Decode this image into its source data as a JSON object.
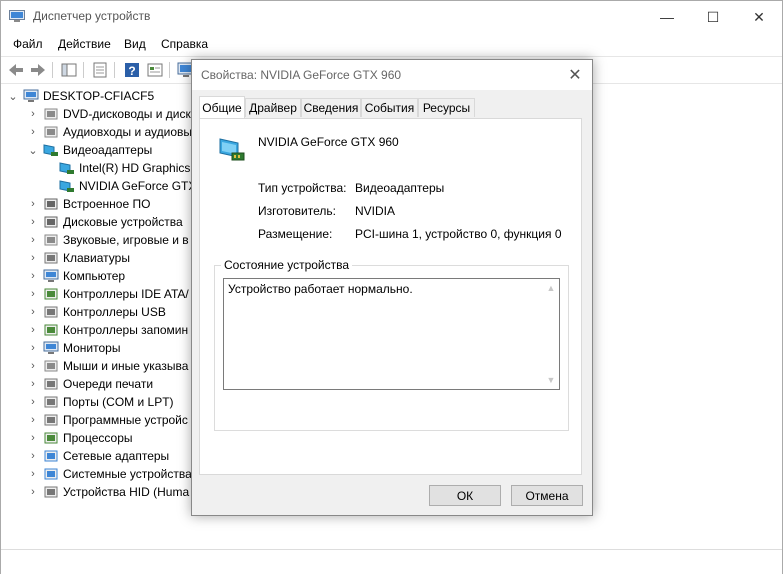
{
  "window": {
    "title": "Диспетчер устройств",
    "icon": "device-manager-icon",
    "controls": {
      "minimize": "—",
      "maximize": "☐",
      "close": "✕"
    }
  },
  "menu": [
    "Файл",
    "Действие",
    "Вид",
    "Справка"
  ],
  "toolbar": [
    "back-arrow-icon",
    "forward-arrow-icon",
    "show-hide-tree-icon",
    "properties-icon",
    "help-icon",
    "details-view-icon",
    "monitor-icon"
  ],
  "tree": {
    "root": "DESKTOP-CFIACF5",
    "items": [
      {
        "label": "DVD-дисководы и дисков",
        "icon": "dvd-drive-icon",
        "expanded": false
      },
      {
        "label": "Аудиовходы и аудиовых",
        "icon": "audio-icon",
        "expanded": false
      },
      {
        "label": "Видеоадаптеры",
        "icon": "display-adapter-icon",
        "expanded": true
      },
      {
        "label": "Intel(R) HD Graphics",
        "icon": "display-adapter-icon",
        "child": true
      },
      {
        "label": "NVIDIA GeForce GTX",
        "icon": "display-adapter-icon",
        "child": true
      },
      {
        "label": "Встроенное ПО",
        "icon": "firmware-icon",
        "expanded": false
      },
      {
        "label": "Дисковые устройства",
        "icon": "disk-drive-icon",
        "expanded": false
      },
      {
        "label": "Звуковые, игровые и в",
        "icon": "sound-icon",
        "expanded": false
      },
      {
        "label": "Клавиатуры",
        "icon": "keyboard-icon",
        "expanded": false
      },
      {
        "label": "Компьютер",
        "icon": "computer-icon",
        "expanded": false
      },
      {
        "label": "Контроллеры IDE ATA/",
        "icon": "ide-controller-icon",
        "expanded": false
      },
      {
        "label": "Контроллеры USB",
        "icon": "usb-icon",
        "expanded": false
      },
      {
        "label": "Контроллеры запомин",
        "icon": "storage-controller-icon",
        "expanded": false
      },
      {
        "label": "Мониторы",
        "icon": "monitor-icon",
        "expanded": false
      },
      {
        "label": "Мыши и иные указыва",
        "icon": "mouse-icon",
        "expanded": false
      },
      {
        "label": "Очереди печати",
        "icon": "printer-icon",
        "expanded": false
      },
      {
        "label": "Порты (COM и LPT)",
        "icon": "port-icon",
        "expanded": false
      },
      {
        "label": "Программные устройс",
        "icon": "software-device-icon",
        "expanded": false
      },
      {
        "label": "Процессоры",
        "icon": "processor-icon",
        "expanded": false
      },
      {
        "label": "Сетевые адаптеры",
        "icon": "network-adapter-icon",
        "expanded": false
      },
      {
        "label": "Системные устройства",
        "icon": "system-device-icon",
        "expanded": false
      },
      {
        "label": "Устройства HID (Huma",
        "icon": "hid-device-icon",
        "expanded": false
      }
    ]
  },
  "dialog": {
    "title": "Свойства: NVIDIA GeForce GTX 960",
    "close": "✕",
    "tabs": [
      "Общие",
      "Драйвер",
      "Сведения",
      "События",
      "Ресурсы"
    ],
    "active_tab": "Общие",
    "device_name": "NVIDIA GeForce GTX 960",
    "props": [
      {
        "label": "Тип устройства:",
        "value": "Видеоадаптеры"
      },
      {
        "label": "Изготовитель:",
        "value": "NVIDIA"
      },
      {
        "label": "Размещение:",
        "value": "PCI-шина 1, устройство 0, функция 0"
      }
    ],
    "status_group_title": "Состояние устройства",
    "status_text": "Устройство работает нормально.",
    "ok": "ОК",
    "cancel": "Отмена"
  }
}
